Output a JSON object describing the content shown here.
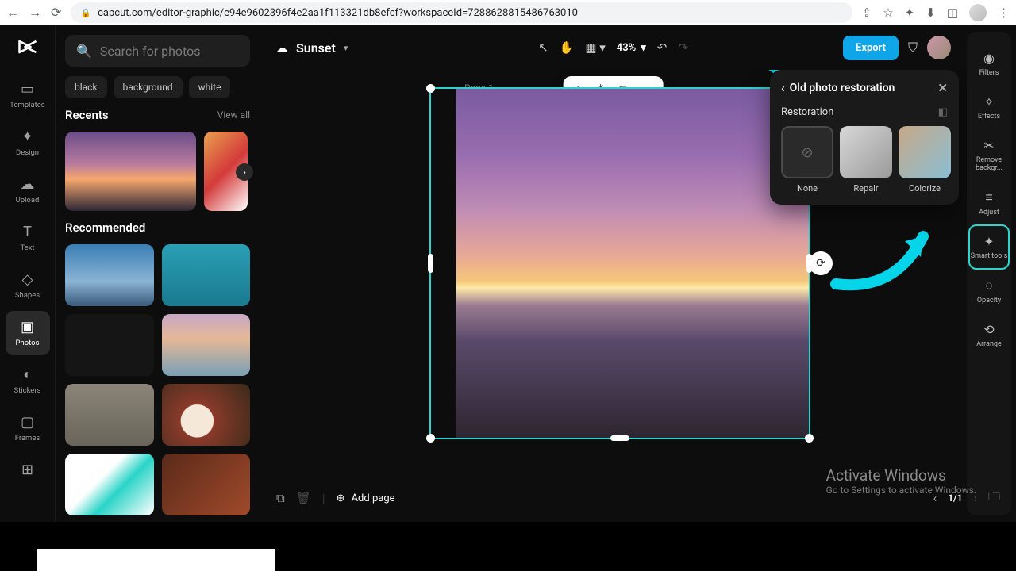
{
  "browser": {
    "url": "capcut.com/editor-graphic/e94e9602396f4e2aa1f113321db8efcf?workspaceId=7288628815486763010"
  },
  "left_rail": {
    "items": [
      {
        "icon": "▭",
        "label": "Templates"
      },
      {
        "icon": "✦",
        "label": "Design"
      },
      {
        "icon": "☁",
        "label": "Upload"
      },
      {
        "icon": "T",
        "label": "Text"
      },
      {
        "icon": "◇",
        "label": "Shapes"
      },
      {
        "icon": "▣",
        "label": "Photos"
      },
      {
        "icon": "◐",
        "label": "Stickers"
      },
      {
        "icon": "▢",
        "label": "Frames"
      }
    ],
    "active_index": 5
  },
  "left_panel": {
    "search_placeholder": "Search for photos",
    "tags": [
      "black",
      "background",
      "white"
    ],
    "recents_title": "Recents",
    "view_all": "View all",
    "recommended_title": "Recommended"
  },
  "topbar": {
    "doc_name": "Sunset",
    "zoom": "43%",
    "export": "Export"
  },
  "canvas": {
    "page_label": "Page 1"
  },
  "popover": {
    "title": "Old photo restoration",
    "section": "Restoration",
    "options": [
      {
        "label": "None"
      },
      {
        "label": "Repair"
      },
      {
        "label": "Colorize"
      }
    ]
  },
  "right_rail": {
    "items": [
      {
        "icon": "◉",
        "label": "Filters"
      },
      {
        "icon": "✧",
        "label": "Effects"
      },
      {
        "icon": "✂",
        "label": "Remove backgr..."
      },
      {
        "icon": "≡",
        "label": "Adjust"
      },
      {
        "icon": "✦",
        "label": "Smart tools"
      },
      {
        "icon": "◌",
        "label": "Opacity"
      },
      {
        "icon": "⟲",
        "label": "Arrange"
      }
    ],
    "highlight_index": 4
  },
  "bottom": {
    "add_page": "Add page",
    "pager": "1/1"
  },
  "watermark": {
    "line1": "Activate Windows",
    "line2": "Go to Settings to activate Windows."
  }
}
